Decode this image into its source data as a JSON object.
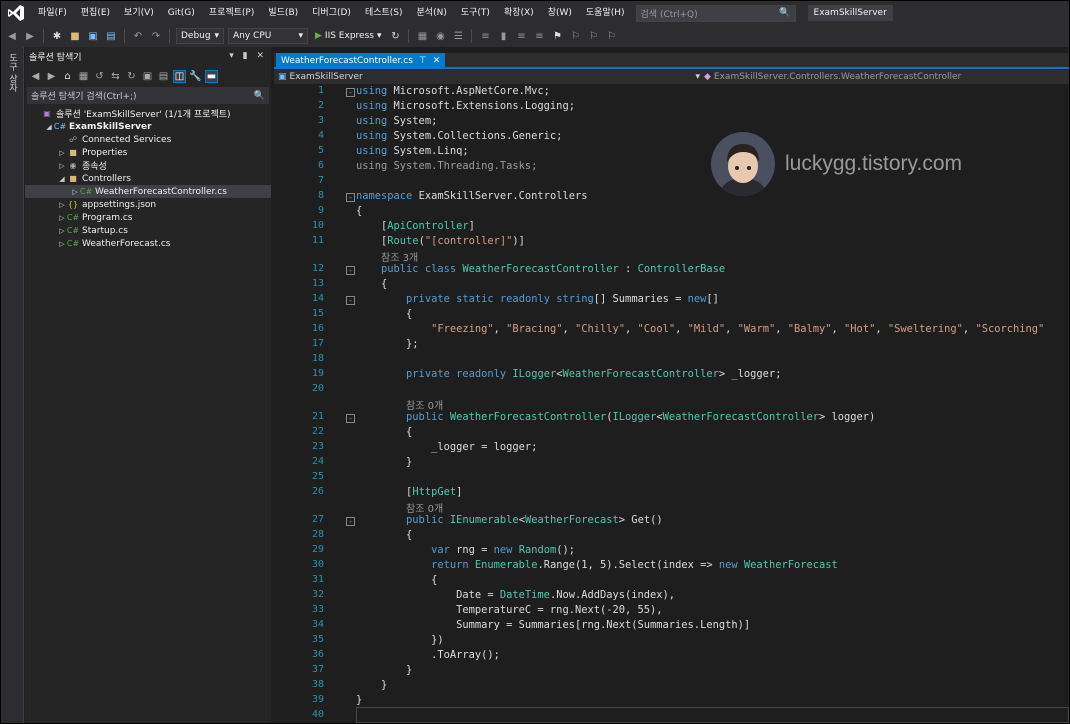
{
  "menu": [
    "파일(F)",
    "편집(E)",
    "보기(V)",
    "Git(G)",
    "프로젝트(P)",
    "빌드(B)",
    "디버그(D)",
    "테스트(S)",
    "분석(N)",
    "도구(T)",
    "확장(X)",
    "창(W)",
    "도움말(H)"
  ],
  "search": {
    "placeholder": "검색 (Ctrl+Q)"
  },
  "window_title": "ExamSkillServer",
  "toolbar": {
    "config": "Debug",
    "platform": "Any CPU",
    "run_target": "IIS Express"
  },
  "vertical_tab": "도구 상자",
  "solution_explorer": {
    "title": "솔루션 탐색기",
    "search_label": "솔루션 탐색기 검색(Ctrl+;)",
    "nodes": [
      {
        "label": "솔루션 'ExamSkillServer' (1/1개 프로젝트)",
        "icon": "solution-icon",
        "level": 0
      },
      {
        "label": "ExamSkillServer",
        "icon": "csharp-project-icon",
        "level": 1
      },
      {
        "label": "Connected Services",
        "icon": "connected-services-icon",
        "level": 2
      },
      {
        "label": "Properties",
        "icon": "wrench-folder-icon",
        "level": 2
      },
      {
        "label": "종속성",
        "icon": "dependencies-icon",
        "level": 2
      },
      {
        "label": "Controllers",
        "icon": "folder-icon",
        "level": 2
      },
      {
        "label": "WeatherForecastController.cs",
        "icon": "csharp-file-icon",
        "level": 3
      },
      {
        "label": "appsettings.json",
        "icon": "json-file-icon",
        "level": 2
      },
      {
        "label": "Program.cs",
        "icon": "csharp-file-icon",
        "level": 2
      },
      {
        "label": "Startup.cs",
        "icon": "csharp-file-icon",
        "level": 2
      },
      {
        "label": "WeatherForecast.cs",
        "icon": "csharp-file-icon",
        "level": 2
      }
    ]
  },
  "editor": {
    "tab": "WeatherForecastController.cs",
    "nav_left": "ExamSkillServer",
    "nav_right": "ExamSkillServer.Controllers.WeatherForecastController",
    "watermark": "luckygg.tistory.com",
    "codelens": [
      "참조 3개",
      "참조 0개",
      "참조 0개"
    ],
    "lines": [
      "using Microsoft.AspNetCore.Mvc;",
      "using Microsoft.Extensions.Logging;",
      "using System;",
      "using System.Collections.Generic;",
      "using System.Linq;",
      "using System.Threading.Tasks;",
      "",
      "namespace ExamSkillServer.Controllers",
      "{",
      "    [ApiController]",
      "    [Route(\"[controller]\")]",
      "    public class WeatherForecastController : ControllerBase",
      "    {",
      "        private static readonly string[] Summaries = new[]",
      "        {",
      "            \"Freezing\", \"Bracing\", \"Chilly\", \"Cool\", \"Mild\", \"Warm\", \"Balmy\", \"Hot\", \"Sweltering\", \"Scorching\"",
      "        };",
      "",
      "        private readonly ILogger<WeatherForecastController> _logger;",
      "",
      "        public WeatherForecastController(ILogger<WeatherForecastController> logger)",
      "        {",
      "            _logger = logger;",
      "        }",
      "",
      "        [HttpGet]",
      "        public IEnumerable<WeatherForecast> Get()",
      "        {",
      "            var rng = new Random();",
      "            return Enumerable.Range(1, 5).Select(index => new WeatherForecast",
      "            {",
      "                Date = DateTime.Now.AddDays(index),",
      "                TemperatureC = rng.Next(-20, 55),",
      "                Summary = Summaries[rng.Next(Summaries.Length)]",
      "            })",
      "            .ToArray();",
      "        }",
      "    }",
      "}",
      ""
    ]
  }
}
